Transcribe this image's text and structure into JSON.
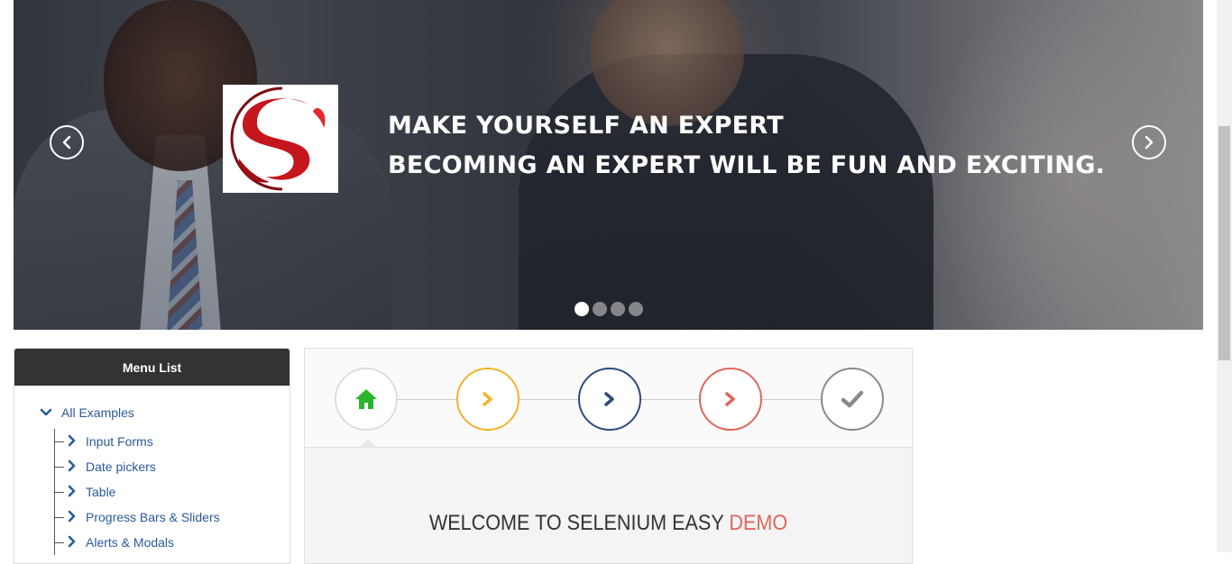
{
  "hero": {
    "line1": "MAKE YOURSELF AN EXPERT",
    "line2": "BECOMING AN EXPERT WILL BE FUN AND EXCITING.",
    "prev_icon": "chevron-left-icon",
    "next_icon": "chevron-right-icon",
    "slide_count": 4,
    "active_slide": 1
  },
  "menu": {
    "title": "Menu List",
    "root": "All Examples",
    "items": [
      {
        "label": "Input Forms"
      },
      {
        "label": "Date pickers"
      },
      {
        "label": "Table"
      },
      {
        "label": "Progress Bars & Sliders"
      },
      {
        "label": "Alerts & Modals"
      }
    ]
  },
  "steps": {
    "icons": [
      "home-icon",
      "chevron-right-icon",
      "chevron-right-icon",
      "chevron-right-icon",
      "check-icon"
    ],
    "colors": [
      "#2bb52b",
      "#f3b32a",
      "#2f4a7e",
      "#e0655a",
      "#8a8a8a"
    ]
  },
  "welcome": {
    "main": "WELCOME TO SELENIUM EASY ",
    "accent": "DEMO"
  }
}
